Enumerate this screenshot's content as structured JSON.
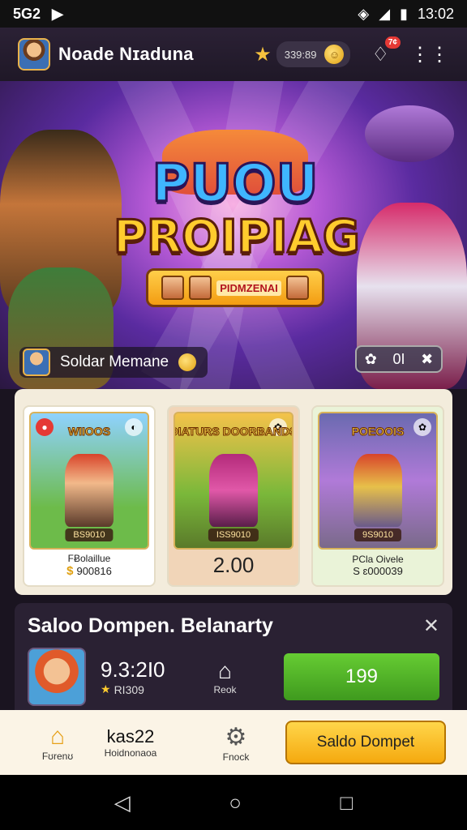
{
  "status_bar": {
    "carrier": "5G2",
    "time": "13:02"
  },
  "header": {
    "title": "Noade Nɪaduna",
    "currency_value": "339:89",
    "notif_badge": "7¢"
  },
  "banner": {
    "logo_line1": "PUOU",
    "logo_line2": "PROIPIAG",
    "logo_plate_text": "PIDMZENAI",
    "chip_label": "Soldar Memane",
    "ctrl_label": "0I"
  },
  "games": [
    {
      "thumb_title": "WIIOOS",
      "badge": "BS9010",
      "name": "FɃolaillue",
      "price": "900816"
    },
    {
      "thumb_title": "DIATURS DOORBANDS",
      "badge": "ISS9010",
      "name": "",
      "price": "2.00"
    },
    {
      "thumb_title": "POEOOIS",
      "badge": "9S9010",
      "name": "PCla Oivele",
      "price": "S ɛ000039"
    }
  ],
  "panel": {
    "title": "Saloo Dompen. Belanarty",
    "amount": "9.3:2I0",
    "sub_value": "RI309",
    "mid_label": "Reok",
    "button_label": "199"
  },
  "bottom_nav": {
    "home_label": "Fʊrenʊ",
    "kas_text": "kas22",
    "kas_label": "Hoidnonaoa",
    "settings_label": "Fnock",
    "cta_label": "Saldo Dompet"
  },
  "colors": {
    "accent": "#f5a90f",
    "green": "#4caf2a",
    "panel": "#2a2133"
  }
}
